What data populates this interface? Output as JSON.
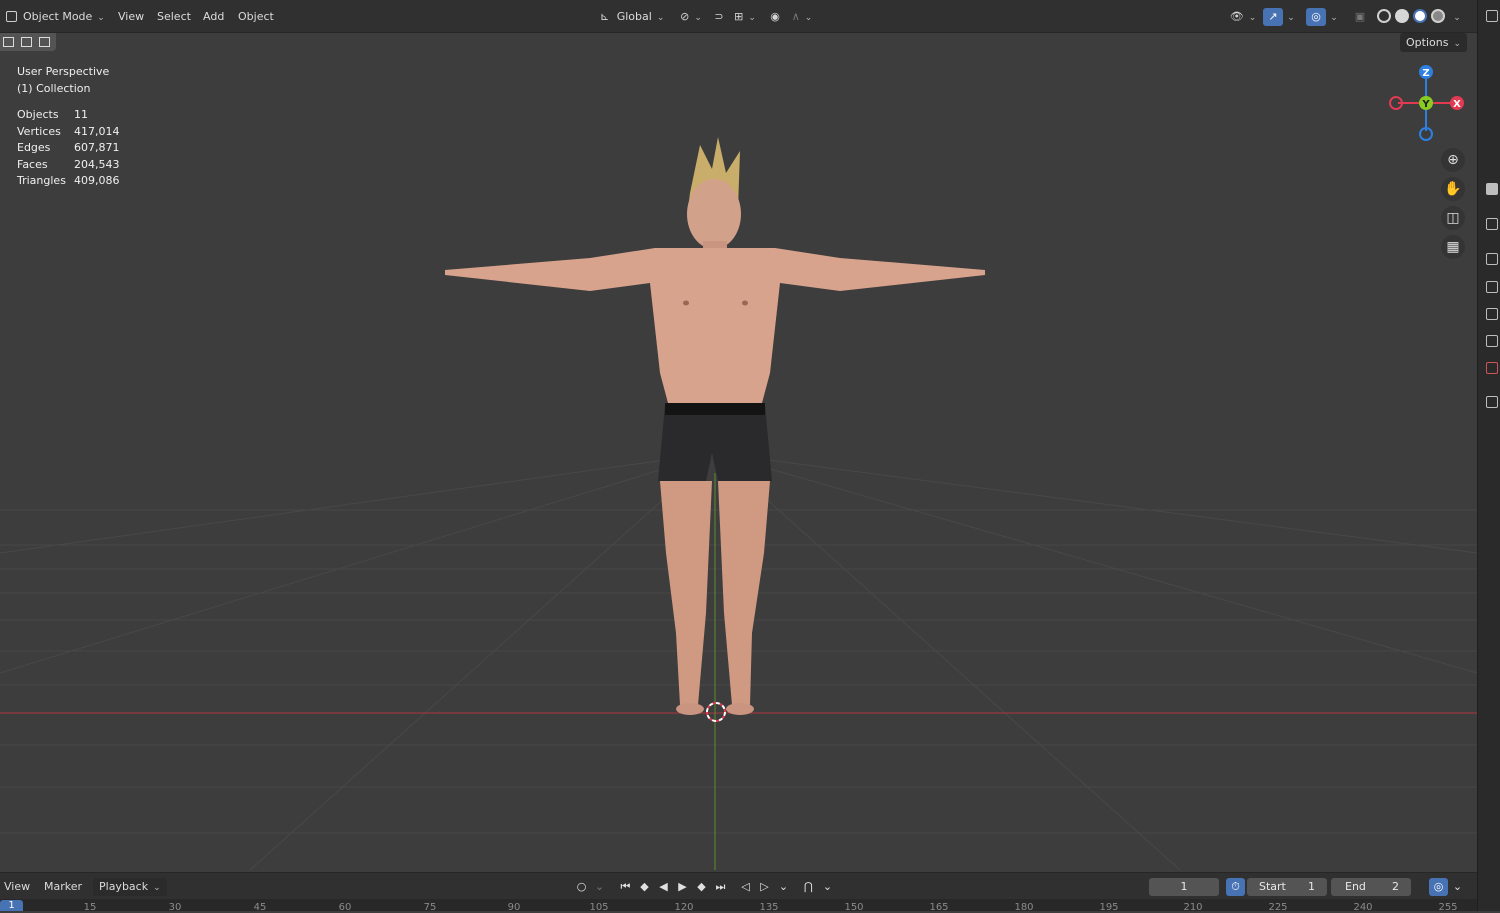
{
  "header": {
    "mode_label": "Object Mode",
    "menu": [
      "View",
      "Select",
      "Add",
      "Object"
    ],
    "orientation_label": "Global",
    "icons": [
      "transform-orientation-icon",
      "pivot-icon",
      "snap-icon",
      "snap-target-icon",
      "proportional-edit-icon",
      "falloff-icon",
      "visibility-icon",
      "gizmo-icon",
      "overlay-icon",
      "xray-icon",
      "wireframe-shading-icon",
      "solid-shading-icon",
      "material-shading-icon",
      "rendered-shading-icon"
    ]
  },
  "viewport": {
    "view_name": "User Perspective",
    "collection": "(1) Collection",
    "stats": [
      {
        "label": "Objects",
        "value": "11"
      },
      {
        "label": "Vertices",
        "value": "417,014"
      },
      {
        "label": "Edges",
        "value": "607,871"
      },
      {
        "label": "Faces",
        "value": "204,543"
      },
      {
        "label": "Triangles",
        "value": "409,086"
      }
    ],
    "options_label": "Options",
    "gizmo_axes": {
      "z": "Z",
      "y": "Y",
      "x": "X"
    },
    "nav_icons": [
      "zoom-icon",
      "pan-hand-icon",
      "camera-view-icon",
      "ortho-grid-icon"
    ],
    "colors": {
      "x_axis": "#e23a52",
      "y_axis": "#8acb22",
      "z_axis": "#2d7fe0",
      "background": "#3d3d3d"
    }
  },
  "timeline": {
    "menu": [
      "View",
      "Marker",
      "Playback"
    ],
    "current_frame": "1",
    "start_label": "Start",
    "start_value": "1",
    "end_label": "End",
    "end_value": "2",
    "ruler_ticks": [
      "15",
      "30",
      "45",
      "60",
      "75",
      "90",
      "105",
      "120",
      "135",
      "150",
      "165",
      "180",
      "195",
      "210",
      "225",
      "240",
      "255"
    ],
    "ruler_current": "1"
  }
}
